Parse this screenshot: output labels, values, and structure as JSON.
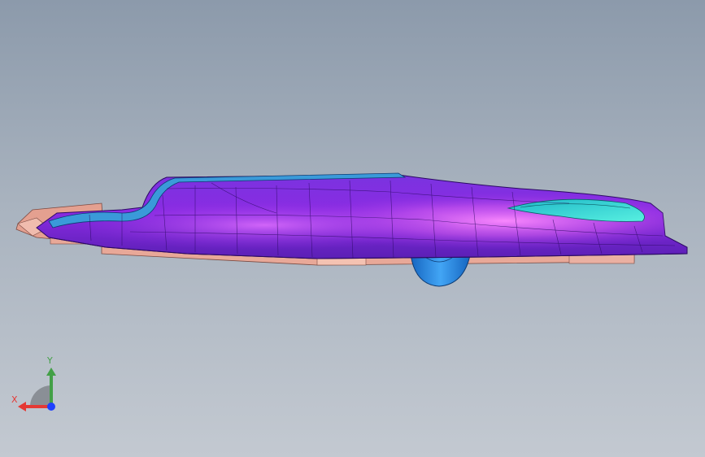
{
  "viewport": {
    "background_top": "#8c9aab",
    "background_bottom": "#c3c9d1"
  },
  "model": {
    "shell_color": "#8a2be2",
    "highlight_color": "#e060ff",
    "pocket_color": "#2bd4d0",
    "lip_color": "#3a9ad9",
    "base_color": "#e8a898",
    "knob_color": "#1e88e5"
  },
  "triad": {
    "x_label": "X",
    "y_label": "Y",
    "x_color": "#e53935",
    "y_color": "#43a047",
    "z_color": "#1e40ff",
    "wedge_color": "#8a8f96"
  }
}
